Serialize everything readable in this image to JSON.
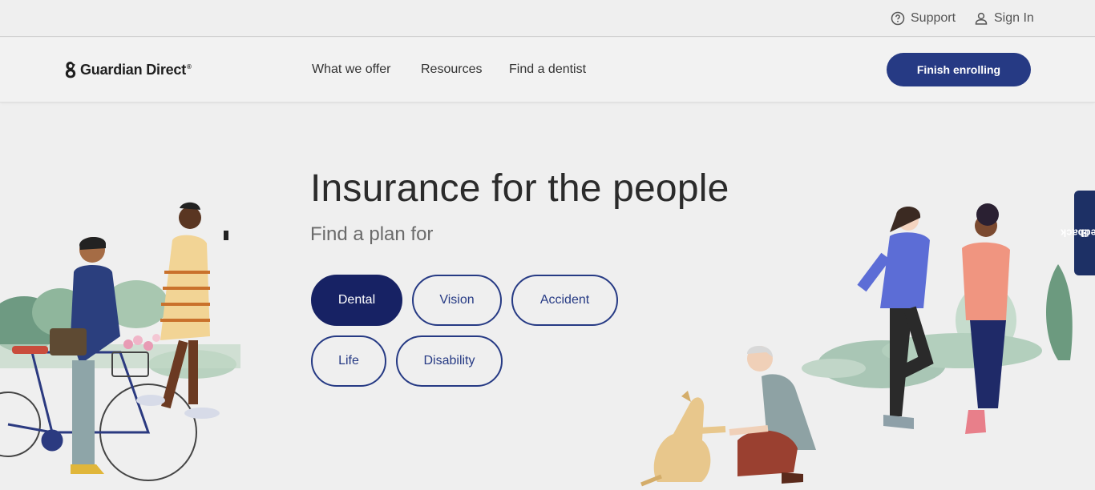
{
  "utility": {
    "support_label": "Support",
    "signin_label": "Sign In"
  },
  "nav": {
    "logo_text": "Guardian Direct",
    "logo_mark": "®",
    "links": [
      "What we offer",
      "Resources",
      "Find a dentist"
    ],
    "cta_label": "Finish enrolling"
  },
  "hero": {
    "title": "Insurance for the people",
    "subtitle": "Find a plan for",
    "plans": [
      "Dental",
      "Vision",
      "Accident",
      "Life",
      "Disability"
    ],
    "selected_plan": "Dental"
  },
  "feedback_label": "Feedback",
  "colors": {
    "brand": "#263a84",
    "selected": "#172264",
    "background": "#efefef"
  },
  "icons": {
    "support": "question-circle-icon",
    "signin": "person-icon",
    "logo": "guardian-g-icon",
    "feedback": "feedback-icon"
  }
}
